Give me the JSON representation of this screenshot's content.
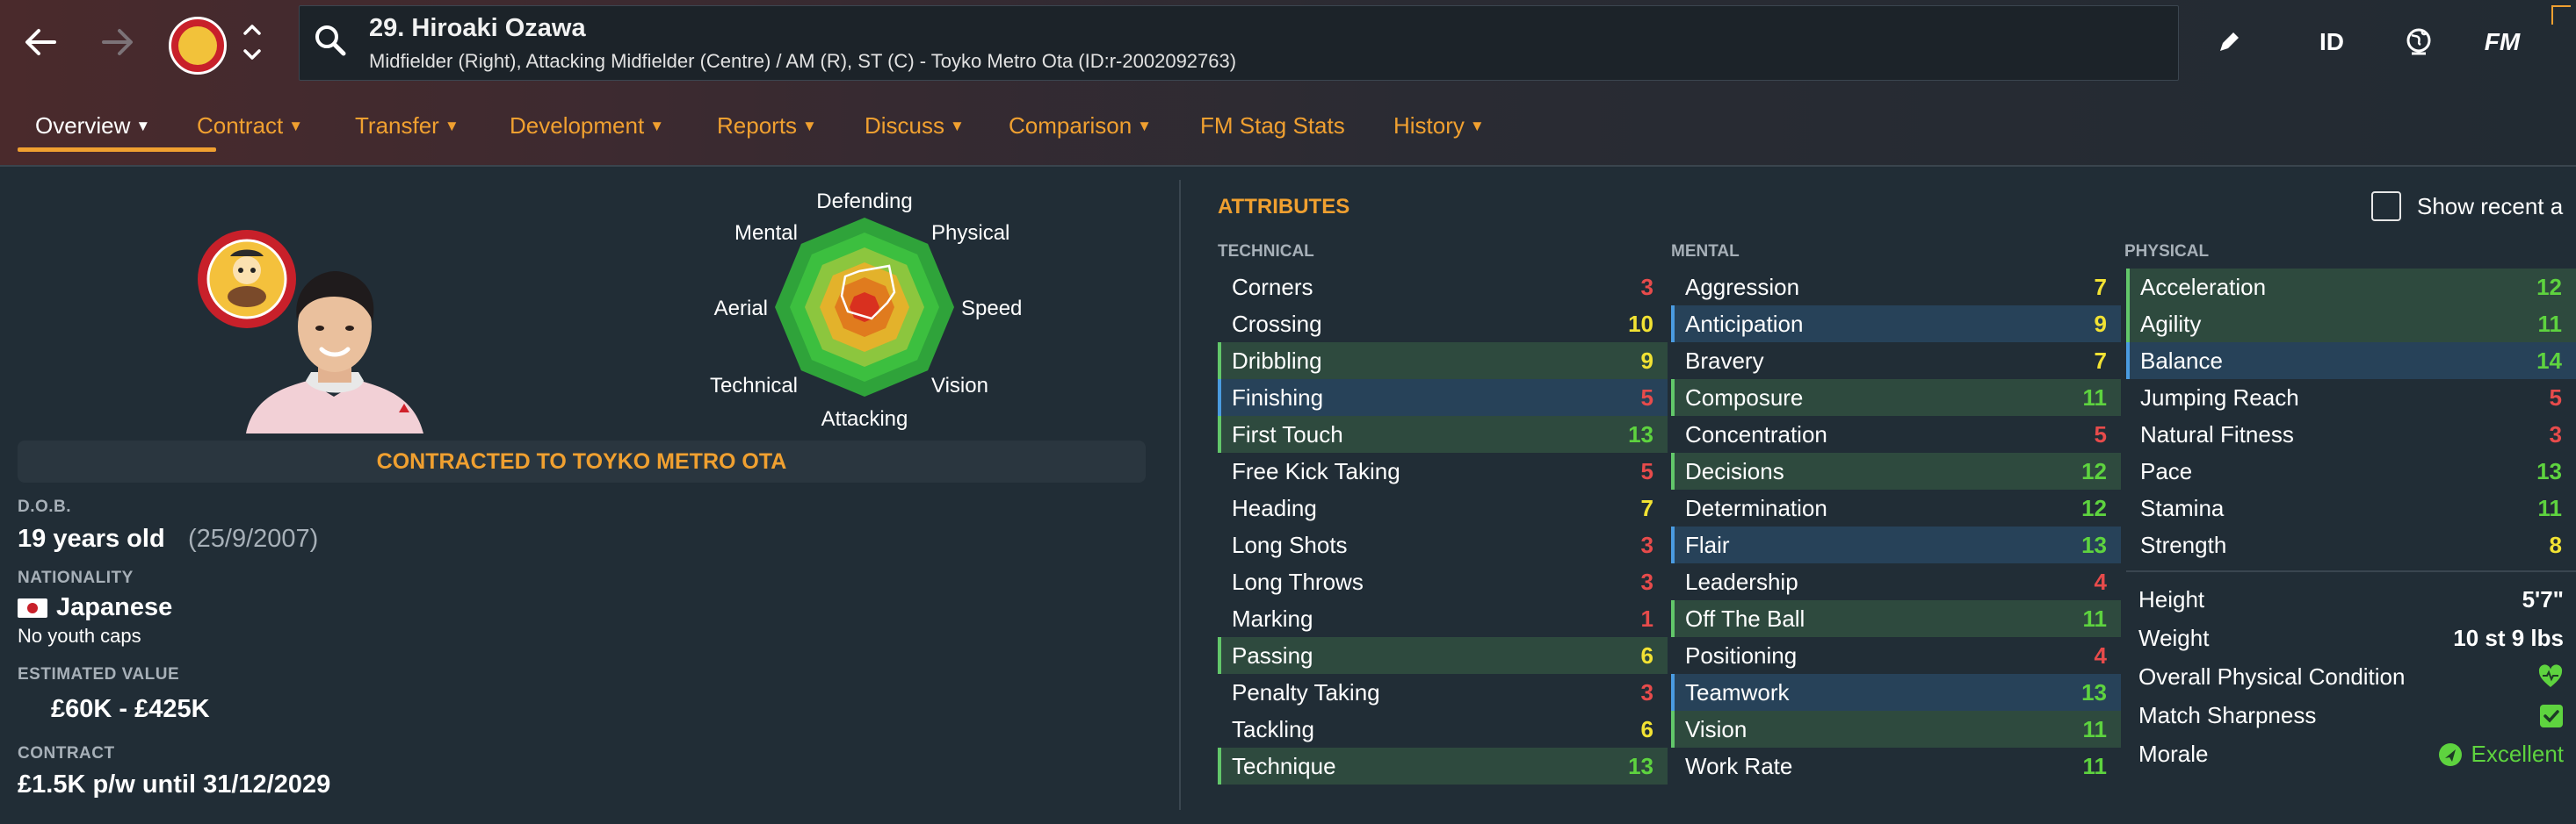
{
  "header": {
    "player_name": "29. Hiroaki Ozawa",
    "description": "Midfielder (Right), Attacking Midfielder (Centre) / AM (R), ST (C) - Toyko Metro Ota (ID:r-2002092763)",
    "id_label": "ID",
    "fm_label": "FM"
  },
  "tabs": [
    {
      "label": "Overview"
    },
    {
      "label": "Contract"
    },
    {
      "label": "Transfer"
    },
    {
      "label": "Development"
    },
    {
      "label": "Reports"
    },
    {
      "label": "Discuss"
    },
    {
      "label": "Comparison"
    },
    {
      "label": "FM Stag Stats"
    },
    {
      "label": "History"
    }
  ],
  "profile": {
    "contracted_text": "CONTRACTED TO TOYKO METRO OTA",
    "dob_label": "D.O.B.",
    "age": "19 years old",
    "dob": "(25/9/2007)",
    "nationality_label": "NATIONALITY",
    "nationality": "Japanese",
    "youth_caps": "No youth caps",
    "value_label": "ESTIMATED VALUE",
    "value": "£60K - £425K",
    "contract_label": "CONTRACT",
    "contract": "£1.5K p/w until 31/12/2029"
  },
  "radar": {
    "labels": [
      "Defending",
      "Physical",
      "Speed",
      "Vision",
      "Attacking",
      "Technical",
      "Aerial",
      "Mental"
    ],
    "colors": [
      "#2fa33a",
      "#3cbf3f",
      "#8cc63e",
      "#e3b22b",
      "#e07b1e",
      "#d9301f"
    ]
  },
  "attributes": {
    "title": "ATTRIBUTES",
    "show_recent": "Show recent a",
    "technical_label": "TECHNICAL",
    "mental_label": "MENTAL",
    "physical_label": "PHYSICAL",
    "technical": [
      {
        "name": "Corners",
        "value": "3",
        "hl": ""
      },
      {
        "name": "Crossing",
        "value": "10",
        "hl": ""
      },
      {
        "name": "Dribbling",
        "value": "9",
        "hl": "g"
      },
      {
        "name": "Finishing",
        "value": "5",
        "hl": "b"
      },
      {
        "name": "First Touch",
        "value": "13",
        "hl": "g"
      },
      {
        "name": "Free Kick Taking",
        "value": "5",
        "hl": ""
      },
      {
        "name": "Heading",
        "value": "7",
        "hl": ""
      },
      {
        "name": "Long Shots",
        "value": "3",
        "hl": ""
      },
      {
        "name": "Long Throws",
        "value": "3",
        "hl": ""
      },
      {
        "name": "Marking",
        "value": "1",
        "hl": ""
      },
      {
        "name": "Passing",
        "value": "6",
        "hl": "g"
      },
      {
        "name": "Penalty Taking",
        "value": "3",
        "hl": ""
      },
      {
        "name": "Tackling",
        "value": "6",
        "hl": ""
      },
      {
        "name": "Technique",
        "value": "13",
        "hl": "g"
      }
    ],
    "mental": [
      {
        "name": "Aggression",
        "value": "7",
        "hl": ""
      },
      {
        "name": "Anticipation",
        "value": "9",
        "hl": "b"
      },
      {
        "name": "Bravery",
        "value": "7",
        "hl": ""
      },
      {
        "name": "Composure",
        "value": "11",
        "hl": "g"
      },
      {
        "name": "Concentration",
        "value": "5",
        "hl": ""
      },
      {
        "name": "Decisions",
        "value": "12",
        "hl": "g"
      },
      {
        "name": "Determination",
        "value": "12",
        "hl": ""
      },
      {
        "name": "Flair",
        "value": "13",
        "hl": "b"
      },
      {
        "name": "Leadership",
        "value": "4",
        "hl": ""
      },
      {
        "name": "Off The Ball",
        "value": "11",
        "hl": "g"
      },
      {
        "name": "Positioning",
        "value": "4",
        "hl": ""
      },
      {
        "name": "Teamwork",
        "value": "13",
        "hl": "b"
      },
      {
        "name": "Vision",
        "value": "11",
        "hl": "g"
      },
      {
        "name": "Work Rate",
        "value": "11",
        "hl": ""
      }
    ],
    "physical": [
      {
        "name": "Acceleration",
        "value": "12",
        "hl": "g"
      },
      {
        "name": "Agility",
        "value": "11",
        "hl": "g"
      },
      {
        "name": "Balance",
        "value": "14",
        "hl": "b"
      },
      {
        "name": "Jumping Reach",
        "value": "5",
        "hl": ""
      },
      {
        "name": "Natural Fitness",
        "value": "3",
        "hl": ""
      },
      {
        "name": "Pace",
        "value": "13",
        "hl": ""
      },
      {
        "name": "Stamina",
        "value": "11",
        "hl": ""
      },
      {
        "name": "Strength",
        "value": "8",
        "hl": ""
      }
    ],
    "extra": {
      "height_label": "Height",
      "height": "5'7\"",
      "weight_label": "Weight",
      "weight": "10 st 9 lbs",
      "condition_label": "Overall Physical Condition",
      "sharpness_label": "Match Sharpness",
      "morale_label": "Morale",
      "morale": "Excellent"
    }
  },
  "colors": {
    "accent": "#f0a030",
    "good": "#5ed33f",
    "mid": "#f2e233",
    "bad": "#e74b4b"
  }
}
